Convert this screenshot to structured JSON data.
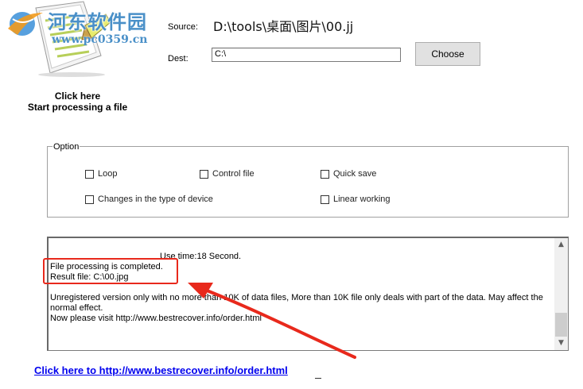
{
  "watermark": {
    "site_name": "河东软件园",
    "site_url": "www.pc0359.cn"
  },
  "launcher": {
    "line1": "Click here",
    "line2": "Start processing a file"
  },
  "source": {
    "label": "Source:",
    "value": "D:\\tools\\桌面\\图片\\00.jj"
  },
  "dest": {
    "label": "Dest:",
    "value": "C:\\"
  },
  "choose_button": "Choose",
  "options": {
    "legend": "Option",
    "items": {
      "loop": "Loop",
      "control_file": "Control file",
      "quick_save": "Quick save",
      "device_change": "Changes in the type of device",
      "linear_working": "Linear working"
    }
  },
  "log": {
    "lines": [
      "Use time:18 Second.",
      "File processing is completed.",
      "Result file: C:\\00.jpg",
      "",
      "Unregistered version only with no more than 10K of data files, More than 10K file only deals with part of the data. May affect the normal effect.",
      "Now please visit http://www.bestrecover.info/order.html"
    ]
  },
  "bottom_link": "Click here to http://www.bestrecover.info/order.html",
  "colors": {
    "highlight": "#e8291c",
    "link": "#0000ee",
    "watermark": "#4a90c8"
  }
}
